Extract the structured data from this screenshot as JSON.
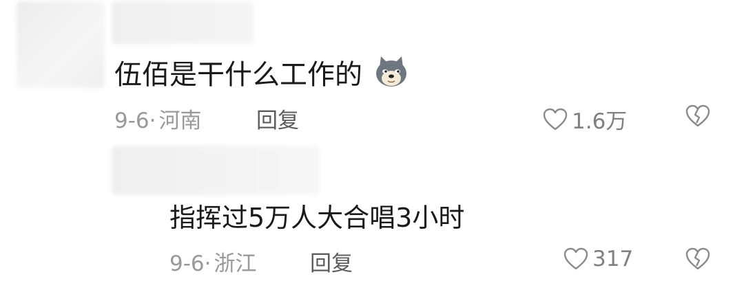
{
  "comment": {
    "text": "伍佰是干什么工作的",
    "emoji": "doge-emoji",
    "date": "9-6",
    "separator": "·",
    "location": "河南",
    "reply_label": "回复",
    "likes": "1.6万"
  },
  "reply": {
    "text": "指挥过5万人大合唱3小时",
    "date": "9-6",
    "separator": "·",
    "location": "浙江",
    "reply_label": "回复",
    "likes": "317"
  },
  "icons": {
    "like": "heart-outline-icon",
    "dislike": "broken-heart-icon"
  }
}
